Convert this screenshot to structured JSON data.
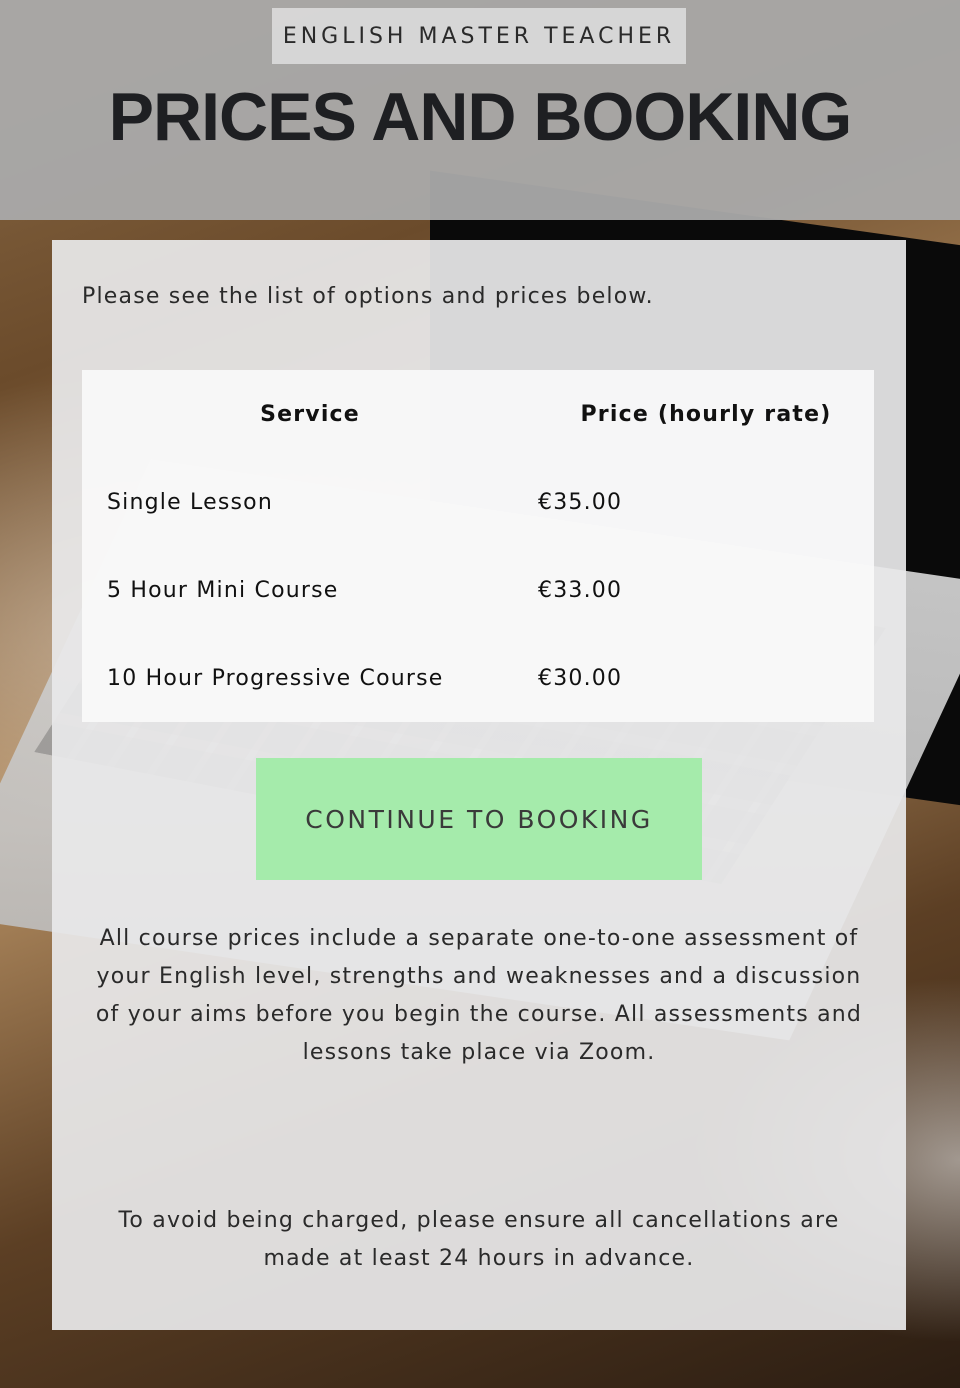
{
  "header": {
    "site_title": "ENGLISH MASTER TEACHER",
    "page_title": "PRICES AND BOOKING"
  },
  "content": {
    "intro": "Please see the list of options and prices below.",
    "table": {
      "columns": [
        "Service",
        "Price (hourly rate)"
      ],
      "rows": [
        {
          "service": "Single Lesson",
          "price": "€35.00"
        },
        {
          "service": "5 Hour Mini Course",
          "price": "€33.00"
        },
        {
          "service": "10 Hour Progressive Course",
          "price": "€30.00"
        }
      ]
    },
    "booking_button": "CONTINUE TO BOOKING",
    "note_assessment": "All course prices include a separate one-to-one assessment of your English level, strengths and weaknesses and a discussion of your aims before you begin the course. All assessments and lessons take place via Zoom.",
    "note_cancellation": "To avoid being charged, please ensure all cancellations are made at least 24 hours in advance."
  },
  "colors": {
    "header_band": "#aaaaaa",
    "button": "#a0eca6",
    "panel": "#e8e8ea"
  }
}
